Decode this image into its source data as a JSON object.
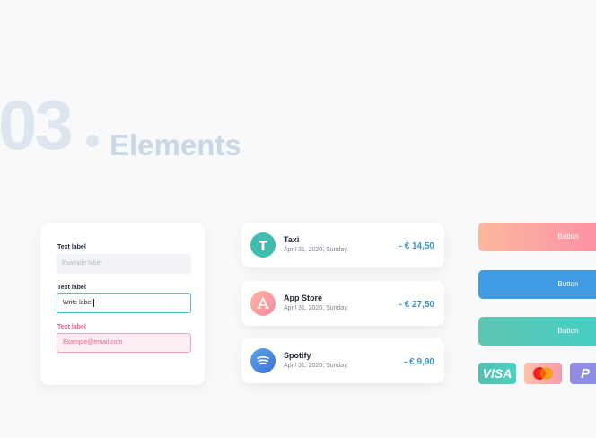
{
  "section": {
    "number": "03",
    "title": "Elements"
  },
  "form": {
    "fields": [
      {
        "label": "Text label",
        "value": "Example label",
        "state": "disabled"
      },
      {
        "label": "Text label",
        "value": "Write label",
        "state": "active"
      },
      {
        "label": "Text label",
        "value": "Example@email.com",
        "state": "error"
      }
    ]
  },
  "transactions": [
    {
      "name": "Taxi",
      "date": "April 31, 2020, Sunday.",
      "amount": "- € 14,50",
      "icon": "taxi-icon",
      "color": "#3fbdae"
    },
    {
      "name": "App Store",
      "date": "April 31, 2020, Sunday.",
      "amount": "- € 27,50",
      "icon": "app-store-icon",
      "color": "#f8909e"
    },
    {
      "name": "Spotify",
      "date": "April 31, 2020, Sunday.",
      "amount": "- € 9,90",
      "icon": "spotify-icon",
      "color": "#4a83dd"
    }
  ],
  "buttons": [
    {
      "label": "Button",
      "style": "pink-gradient"
    },
    {
      "label": "Button",
      "style": "blue"
    },
    {
      "label": "Button",
      "style": "teal-gradient"
    }
  ],
  "payment_methods": [
    {
      "name": "VISA",
      "icon": "visa-icon"
    },
    {
      "name": "Mastercard",
      "icon": "mastercard-icon"
    },
    {
      "name": "PayPal",
      "icon": "paypal-icon"
    }
  ],
  "colors": {
    "accent": "#3396d3",
    "error": "#ea5e86",
    "focus": "#5ab7d8"
  }
}
